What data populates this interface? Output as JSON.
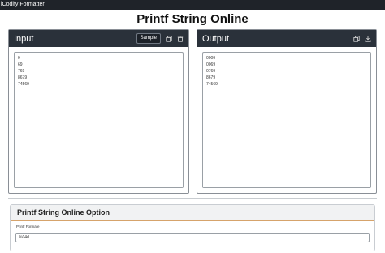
{
  "app": {
    "title": "iCodify Formatter"
  },
  "page": {
    "title": "Printf String Online"
  },
  "input_panel": {
    "title": "Input",
    "sample_label": "Sample",
    "lines": [
      "9",
      "69",
      "769",
      "8679",
      "74569"
    ]
  },
  "output_panel": {
    "title": "Output",
    "lines": [
      "0009",
      "0069",
      "0769",
      "8679",
      "74569"
    ]
  },
  "options": {
    "title": "Printf String Online Option",
    "format_label": "Printf Formate",
    "format_value": "%04d"
  },
  "icons": {
    "copy": "copy-icon",
    "delete": "trash-icon",
    "download": "download-icon"
  },
  "colors": {
    "header_bg": "#2a313a",
    "topbar_bg": "#1f2329",
    "option_accent": "#d6a36b"
  }
}
